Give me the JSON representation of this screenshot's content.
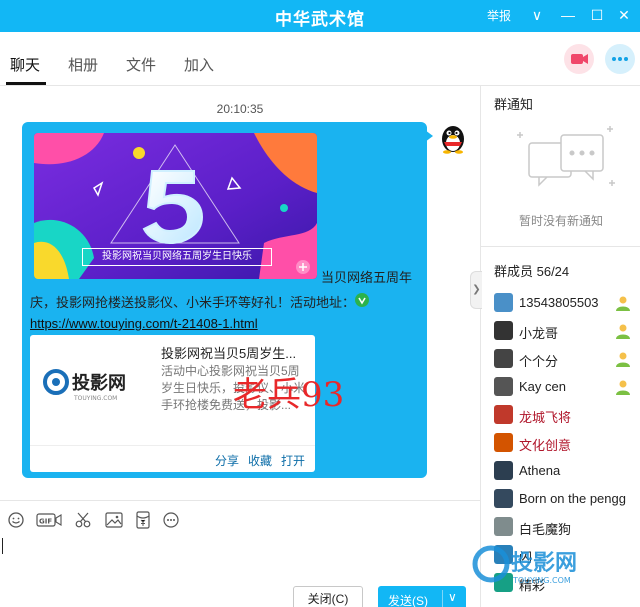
{
  "window": {
    "title": "中华武术馆",
    "report_label": "举报",
    "menu_glyph": "∨",
    "minimize_glyph": "—",
    "maximize_glyph": "☐",
    "close_glyph": "✕"
  },
  "tabs": [
    {
      "label": "聊天",
      "active": true
    },
    {
      "label": "相册",
      "active": false
    },
    {
      "label": "文件",
      "active": false
    },
    {
      "label": "加入",
      "active": false
    }
  ],
  "chat": {
    "timestamp": "20:10:35",
    "message": {
      "banner_number": "5",
      "banner_caption": "投影网祝当贝网络五周岁生日快乐",
      "line1_suffix": "当贝网络五周年",
      "line2": "庆，投影网抢楼送投影仪、小米手环等好礼！活动地址：",
      "link": "https://www.touying.com/t-21408-1.html",
      "card": {
        "title": "投影网祝当贝5周岁生...",
        "description": "活动中心投影网祝当贝5周岁生日快乐，投影仪、小米手环抢楼免费送，投影...",
        "logo_text": "投影网",
        "logo_subtext": "TOUYING.COM",
        "actions": [
          "分享",
          "收藏",
          "打开"
        ]
      }
    },
    "watermark": "老兵93"
  },
  "input": {
    "close_label": "关闭(C)",
    "send_label": "发送(S)",
    "send_dropdown_glyph": "∨"
  },
  "colors": {
    "brand": "#12b7f5",
    "bubble": "#1ab3f0",
    "link": "#0c6da8",
    "watermark": "#e8282a"
  },
  "panel": {
    "notice_heading": "群通知",
    "notice_empty": "暂时没有新通知",
    "members_heading": "群成员 56/24",
    "members": [
      {
        "name": "13543805503",
        "role": "admin",
        "color": "#222"
      },
      {
        "name": "小龙哥",
        "role": "admin",
        "color": "#222"
      },
      {
        "name": "个个分",
        "role": "admin",
        "color": "#222"
      },
      {
        "name": "Kay cen",
        "role": "admin",
        "color": "#222"
      },
      {
        "name": "龙城飞将",
        "role": "",
        "color": "#b0152a"
      },
      {
        "name": "文化创意",
        "role": "",
        "color": "#b0152a"
      },
      {
        "name": "Athena",
        "role": "",
        "color": "#222"
      },
      {
        "name": "Born on the pengg",
        "role": "",
        "color": "#222"
      },
      {
        "name": "白毛魔狗",
        "role": "",
        "color": "#222"
      },
      {
        "name": "闪",
        "role": "",
        "color": "#222"
      },
      {
        "name": "精彩",
        "role": "",
        "color": "#222"
      }
    ],
    "watermark2_text": "投影网",
    "watermark2_sub": "TOUYING.COM"
  }
}
